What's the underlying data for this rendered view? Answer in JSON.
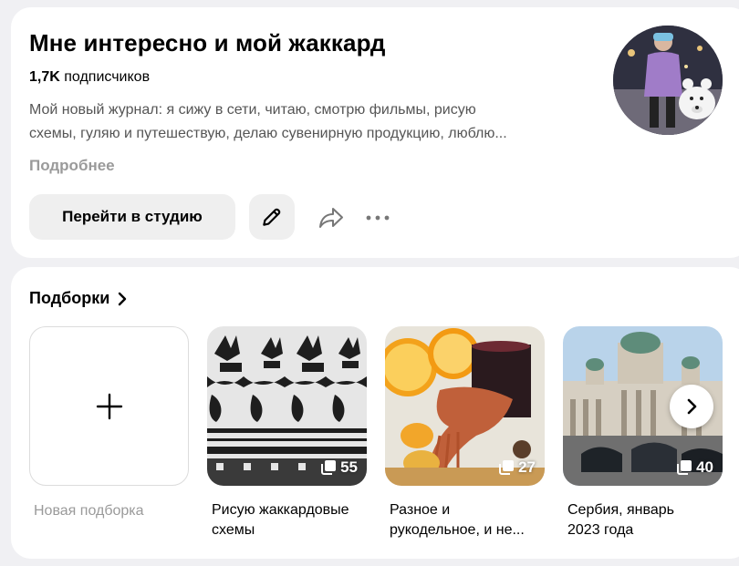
{
  "profile": {
    "title": "Мне интересно и мой жаккард",
    "subscribers_count": "1,7K",
    "subscribers_label": "подписчиков",
    "description_line1": "Мой новый журнал: я сижу в сети, читаю, смотрю фильмы, рисую",
    "description_line2": "схемы, гуляю и путешествую, делаю сувенирную продукцию, люблю...",
    "more_label": "Подробнее",
    "studio_button": "Перейти в студию",
    "icons": {
      "edit": "pencil-icon",
      "share": "share-arrow-icon",
      "more": "more-dots-icon"
    }
  },
  "collections": {
    "title": "Подборки",
    "new_label": "Новая подборка",
    "items": [
      {
        "caption_line1": "Рисую жаккардовые",
        "caption_line2": "схемы",
        "count": "55"
      },
      {
        "caption_line1": "Разное и",
        "caption_line2": "рукодельное, и не...",
        "count": "27"
      },
      {
        "caption_line1": "Сербия, январь",
        "caption_line2": "2023 года",
        "count": "40"
      }
    ]
  },
  "colors": {
    "background": "#f0f0f3",
    "card": "#ffffff",
    "button": "#efefef",
    "muted": "#9a9a9a"
  }
}
